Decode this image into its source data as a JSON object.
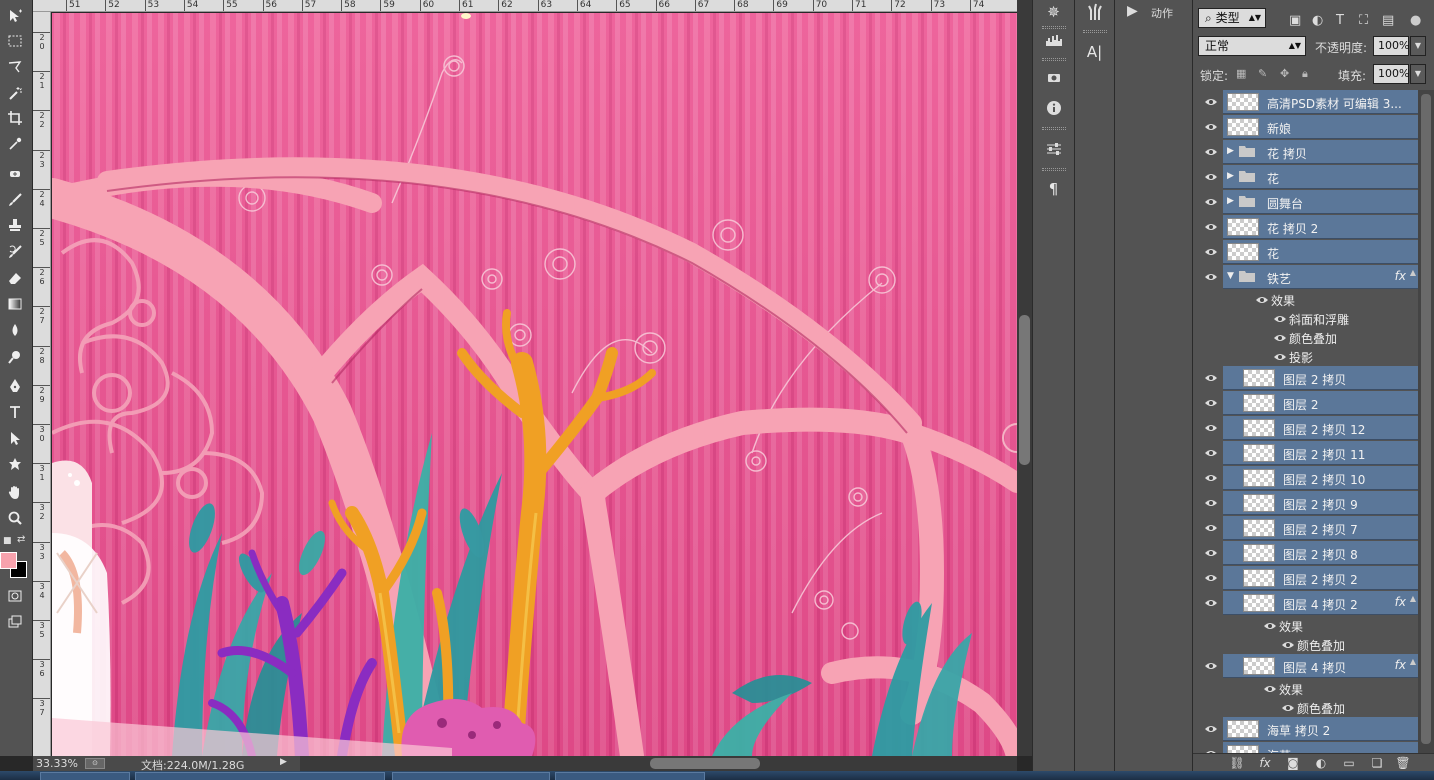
{
  "rulers": {
    "top": [
      "51",
      "52",
      "53",
      "54",
      "55",
      "56",
      "57",
      "58",
      "59",
      "60",
      "61",
      "62",
      "63",
      "64",
      "65",
      "66",
      "67",
      "68",
      "69",
      "70",
      "71",
      "72",
      "73",
      "74"
    ],
    "left": [
      "2 0",
      "2 1",
      "2 2",
      "2 3",
      "2 4",
      "2 5",
      "2 6",
      "2 7",
      "2 8",
      "2 9",
      "3 0",
      "3 1",
      "3 2",
      "3 3",
      "3 4",
      "3 5",
      "3 6",
      "3 7"
    ]
  },
  "status": {
    "zoom": "33.33%",
    "doc_size": "文档:224.0M/1.28G"
  },
  "actions_panel": {
    "label": "动作"
  },
  "layers_panel": {
    "filter_type": "类型",
    "blend_mode": "正常",
    "opacity_label": "不透明度:",
    "opacity_value": "100%",
    "lock_label": "锁定:",
    "fill_label": "填充:",
    "fill_value": "100%"
  },
  "layers": [
    {
      "name": "高清PSD素材 可编辑 3...",
      "kind": "layer",
      "indent": 0
    },
    {
      "name": "新娘",
      "kind": "layer",
      "indent": 0
    },
    {
      "name": "花 拷贝",
      "kind": "group",
      "indent": 0
    },
    {
      "name": "花",
      "kind": "group",
      "indent": 0
    },
    {
      "name": "圆舞台",
      "kind": "group",
      "indent": 0
    },
    {
      "name": "花 拷贝 2",
      "kind": "layer",
      "indent": 0
    },
    {
      "name": "花",
      "kind": "layer",
      "indent": 0
    },
    {
      "name": "铁艺",
      "kind": "group-open",
      "indent": 0,
      "fx": "fx"
    },
    {
      "name": "效果",
      "kind": "effects",
      "indent": 1
    },
    {
      "name": "斜面和浮雕",
      "kind": "effect",
      "indent": 2
    },
    {
      "name": "颜色叠加",
      "kind": "effect",
      "indent": 2
    },
    {
      "name": "投影",
      "kind": "effect",
      "indent": 2
    },
    {
      "name": "图层 2 拷贝",
      "kind": "layer",
      "indent": 1
    },
    {
      "name": "图层 2",
      "kind": "layer",
      "indent": 1
    },
    {
      "name": "图层 2 拷贝 12",
      "kind": "layer",
      "indent": 1
    },
    {
      "name": "图层 2 拷贝 11",
      "kind": "layer",
      "indent": 1
    },
    {
      "name": "图层 2 拷贝 10",
      "kind": "layer",
      "indent": 1
    },
    {
      "name": "图层 2 拷贝 9",
      "kind": "layer",
      "indent": 1
    },
    {
      "name": "图层 2 拷贝 7",
      "kind": "layer",
      "indent": 1
    },
    {
      "name": "图层 2 拷贝 8",
      "kind": "layer",
      "indent": 1
    },
    {
      "name": "图层 2 拷贝 2",
      "kind": "layer",
      "indent": 1
    },
    {
      "name": "图层 4 拷贝 2",
      "kind": "layer",
      "indent": 1,
      "fx": "fx"
    },
    {
      "name": "效果",
      "kind": "effects",
      "indent": 2
    },
    {
      "name": "颜色叠加",
      "kind": "effect",
      "indent": 3
    },
    {
      "name": "图层 4 拷贝",
      "kind": "layer",
      "indent": 1,
      "fx": "fx"
    },
    {
      "name": "效果",
      "kind": "effects",
      "indent": 2
    },
    {
      "name": "颜色叠加",
      "kind": "effect",
      "indent": 3
    },
    {
      "name": "海草 拷贝 2",
      "kind": "layer",
      "indent": 0
    },
    {
      "name": "海草",
      "kind": "layer",
      "indent": 0
    }
  ],
  "colors": {
    "foreground": "#f7a2ad",
    "background": "#000000",
    "selected_layer": "#5b7799"
  }
}
